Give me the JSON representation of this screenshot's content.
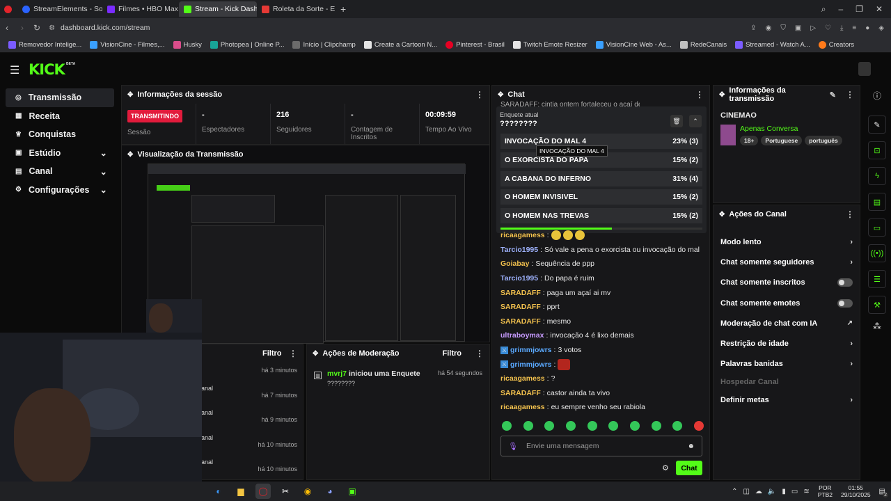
{
  "browser": {
    "tabs": [
      {
        "label": "StreamElements - So",
        "color": "#2b63ff"
      },
      {
        "label": "Filmes • HBO Max",
        "color": "#7b2cff"
      },
      {
        "label": "Stream - Kick Dashboard",
        "color": "#53fc18"
      },
      {
        "label": "Roleta da Sorte - Escolha",
        "color": "#e53935"
      }
    ],
    "url": "dashboard.kick.com/stream",
    "bookmarks": [
      "Removedor Intelige...",
      "VisionCine - Filmes,...",
      "Husky",
      "Photopea | Online P...",
      "Início | Clipchamp",
      "Create a Cartoon N...",
      "Pinterest - Brasil",
      "Twitch Emote Resizer",
      "VisionCine Web - As...",
      "RedeCanais",
      "Streamed - Watch A...",
      "Creators"
    ]
  },
  "kick": {
    "logo": "KICK",
    "logo_badge": "BETA",
    "brand_color": "#53fc18"
  },
  "sidebar": {
    "items": [
      {
        "label": "Transmissão",
        "icon": "broadcast-icon"
      },
      {
        "label": "Receita",
        "icon": "revenue-icon"
      },
      {
        "label": "Conquistas",
        "icon": "trophy-icon"
      },
      {
        "label": "Estúdio",
        "icon": "studio-icon",
        "chevron": true
      },
      {
        "label": "Canal",
        "icon": "channel-icon",
        "chevron": true
      },
      {
        "label": "Configurações",
        "icon": "gear-icon",
        "chevron": true
      }
    ]
  },
  "session": {
    "title": "Informações da sessão",
    "live_badge": "TRANSMITINDO",
    "stats": [
      {
        "value": "",
        "label": "Sessão"
      },
      {
        "value": "-",
        "label": "Espectadores"
      },
      {
        "value": "216",
        "label": "Seguidores"
      },
      {
        "value": "-",
        "label": "Contagem de Inscritos"
      },
      {
        "value": "00:09:59",
        "label": "Tempo Ao Vivo"
      }
    ]
  },
  "preview": {
    "title": "Visualização da Transmissão"
  },
  "filter_panel": {
    "filter_label": "Filtro",
    "rows": [
      {
        "time": "há 3 minutos",
        "text": "anal"
      },
      {
        "time": "há 7 minutos",
        "text": "anal"
      },
      {
        "time": "há 9 minutos",
        "text": "anal"
      },
      {
        "time": "há 10 minutos",
        "text": "anal"
      },
      {
        "time": "há 10 minutos",
        "text": "anal"
      }
    ]
  },
  "moderation": {
    "title": "Ações de Moderação",
    "filter_label": "Filtro",
    "entry": {
      "user": "mvrj7",
      "action": "iniciou uma Enquete",
      "detail": "????????",
      "time": "há 54 segundos"
    }
  },
  "chat": {
    "title": "Chat",
    "top_cut": "SARADAFF: cintia ontem fortaleceu o açaí de Jl",
    "poll": {
      "label": "Enquete atual",
      "question": "????????",
      "tooltip": "INVOCAÇÃO DO MAL 4",
      "options": [
        {
          "label": "INVOCAÇÃO DO MAL 4",
          "result": "23% (3)",
          "percent": 23
        },
        {
          "label": "O EXORCISTA DO PAPA",
          "result": "15% (2)",
          "percent": 15
        },
        {
          "label": "A CABANA DO INFERNO",
          "result": "31% (4)",
          "percent": 31
        },
        {
          "label": "O HOMEM INVISIVEL",
          "result": "15% (2)",
          "percent": 15
        },
        {
          "label": "O HOMEM NAS TREVAS",
          "result": "15% (2)",
          "percent": 15
        }
      ],
      "timer_fraction": 0.55
    },
    "messages": [
      {
        "user": "ricaagamess",
        "text": "",
        "color": "#f2c14e"
      },
      {
        "user": "Tarcio1995",
        "text": "Só vale a pena o exorcista ou invocação do mal",
        "color": "#9fb3ff"
      },
      {
        "user": "Goiabay",
        "text": "Sequência de ppp",
        "color": "#f2c14e"
      },
      {
        "user": "Tarcio1995",
        "text": "Do papa é ruim",
        "color": "#9fb3ff"
      },
      {
        "user": "SARADAFF",
        "text": "paga um açaí ai mv",
        "color": "#f2c14e"
      },
      {
        "user": "SARADAFF",
        "text": "pprt",
        "color": "#f2c14e"
      },
      {
        "user": "SARADAFF",
        "text": "mesmo",
        "color": "#f2c14e"
      },
      {
        "user": "ultraboymax",
        "text": "invocação 4 é lixo demais",
        "color": "#c79bff"
      },
      {
        "user": "grimmjowrs",
        "text": "3 votos",
        "color": "#5aa9ff"
      },
      {
        "user": "grimmjowrs",
        "text": "",
        "color": "#5aa9ff"
      },
      {
        "user": "ricaagamess",
        "text": "?",
        "color": "#f2c14e"
      },
      {
        "user": "SARADAFF",
        "text": "castor ainda ta vivo",
        "color": "#f2c14e"
      },
      {
        "user": "ricaagamess",
        "text": "eu sempre venho seu rabiola",
        "color": "#f2c14e"
      }
    ],
    "input_placeholder": "Envie uma mensagem",
    "send_label": "Chat"
  },
  "stream_info": {
    "title": "Informações da transmissão",
    "channel": "CINEMAO",
    "category": "Apenas Conversa",
    "tags": [
      "18+",
      "Portuguese",
      "português"
    ]
  },
  "channel_actions": {
    "title": "Ações do Canal",
    "items": [
      {
        "label": "Modo lento",
        "control": "arrow"
      },
      {
        "label": "Chat somente seguidores",
        "control": "arrow"
      },
      {
        "label": "Chat somente inscritos",
        "control": "toggle"
      },
      {
        "label": "Chat somente emotes",
        "control": "toggle"
      },
      {
        "label": "Moderação de chat com IA",
        "control": "external"
      },
      {
        "label": "Restrição de idade",
        "control": "arrow"
      },
      {
        "label": "Palavras banidas",
        "control": "arrow"
      },
      {
        "label": "Hospedar Canal",
        "control": "disabled"
      },
      {
        "label": "Definir metas",
        "control": "arrow"
      }
    ]
  },
  "taskbar": {
    "lang": "POR",
    "lang2": "PTB2",
    "time": "01:55",
    "date": "29/10/2025",
    "notif_count": "2"
  }
}
